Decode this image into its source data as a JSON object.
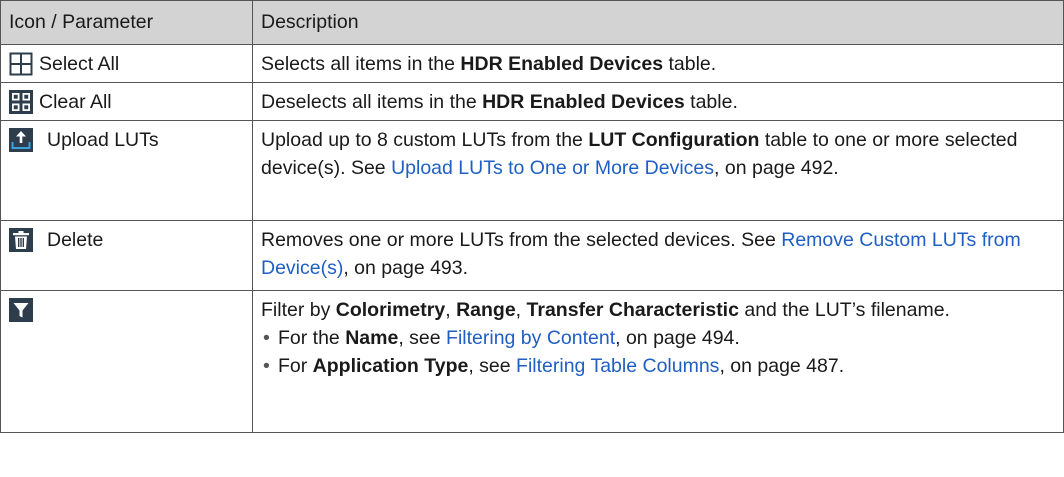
{
  "table": {
    "headers": {
      "col1": "Icon / Parameter",
      "col2": "Description"
    },
    "rows": [
      {
        "param": "Select All",
        "icon": "select-all-icon",
        "desc": {
          "pre": "Selects all items in the ",
          "bold": "HDR Enabled Devices",
          "post": " table."
        }
      },
      {
        "param": "Clear All",
        "icon": "clear-all-icon",
        "desc": {
          "pre": "Deselects all items in the ",
          "bold": "HDR Enabled Devices",
          "post": " table."
        }
      },
      {
        "param": "Upload LUTs",
        "icon": "upload-icon",
        "desc": {
          "pre": "Upload up to 8 custom LUTs from the ",
          "bold": "LUT Configuration",
          "mid": " table to one or more selected device(s). See ",
          "link": "Upload LUTs to One or More Devices",
          "post": ", on page 492."
        }
      },
      {
        "param": "Delete",
        "icon": "trash-icon",
        "desc": {
          "pre": "Removes one or more LUTs from the selected devices. See ",
          "link": "Remove Custom LUTs from Device(s)",
          "post": ", on page 493."
        }
      },
      {
        "param": "",
        "icon": "filter-icon",
        "desc": {
          "pre": "Filter by ",
          "b1": "Colorimetry",
          "s1": ", ",
          "b2": "Range",
          "s2": ", ",
          "b3": "Transfer Characteristic",
          "post": " and the LUT’s filename.",
          "bullets": [
            {
              "pre": "For the ",
              "bold": "Name",
              "mid": ", see ",
              "link": "Filtering by Content",
              "post": ", on page 494."
            },
            {
              "pre": "For ",
              "bold": "Application Type",
              "mid": ", see ",
              "link": "Filtering Table Columns",
              "post": ", on page 487."
            }
          ]
        }
      }
    ]
  },
  "colors": {
    "header_bg": "#d3d3d3",
    "link": "#1f5fc4",
    "icon_dark": "#2e3d4c"
  }
}
